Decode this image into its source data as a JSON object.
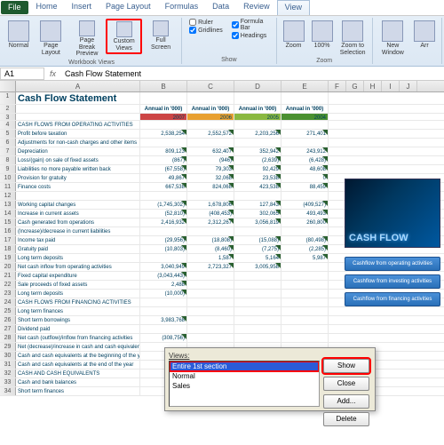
{
  "tabs": [
    "File",
    "Home",
    "Insert",
    "Page Layout",
    "Formulas",
    "Data",
    "Review",
    "View"
  ],
  "active_tab": "View",
  "ribbon": {
    "workbook_views": {
      "title": "Workbook Views",
      "items": [
        "Normal",
        "Page Layout",
        "Page Break Preview",
        "Custom Views",
        "Full Screen"
      ]
    },
    "show": {
      "title": "Show",
      "checks": [
        {
          "label": "Ruler",
          "checked": false
        },
        {
          "label": "Formula Bar",
          "checked": true
        },
        {
          "label": "Gridlines",
          "checked": true
        },
        {
          "label": "Headings",
          "checked": true
        }
      ]
    },
    "zoom": {
      "title": "Zoom",
      "items": [
        "Zoom",
        "100%",
        "Zoom to Selection"
      ]
    },
    "window": {
      "items": [
        "New Window",
        "Arr"
      ]
    }
  },
  "namebox": {
    "cell": "A1",
    "formula": "Cash Flow Statement"
  },
  "columns": [
    "A",
    "B",
    "C",
    "D",
    "E",
    "F",
    "G",
    "H",
    "I",
    "J"
  ],
  "title": "Cash Flow Statement",
  "years": [
    "2007",
    "2006",
    "2005",
    "2004"
  ],
  "sublabel": "Annual in '000)",
  "rows": [
    {
      "label": "CASH FLOWS FROM OPERATING ACTIVITIES",
      "vals": [
        "",
        "",
        "",
        ""
      ]
    },
    {
      "label": "Profit before taxation",
      "vals": [
        "2,538,254",
        "2,552,572",
        "2,203,256",
        "271,401"
      ]
    },
    {
      "label": "Adjustments for non-cash charges and other items",
      "vals": [
        "",
        "",
        "",
        ""
      ]
    },
    {
      "label": "Depreciation",
      "vals": [
        "809,123",
        "632,407",
        "352,942",
        "243,912"
      ]
    },
    {
      "label": "Loss/(gain) on sale of fixed assets",
      "vals": [
        "(867)",
        "(946)",
        "(2,639)",
        "(6,428)"
      ]
    },
    {
      "label": "Liabilities no more payable written back",
      "vals": [
        "(67,558)",
        "79,303",
        "92,429",
        "48,608"
      ]
    },
    {
      "label": "Provision for gratuity",
      "vals": [
        "49,867",
        "32,068",
        "23,538",
        "0"
      ]
    },
    {
      "label": "Finance costs",
      "vals": [
        "667,538",
        "824,068",
        "423,538",
        "88,459"
      ]
    },
    {
      "label": "",
      "vals": [
        "",
        "",
        "",
        ""
      ]
    },
    {
      "label": "Working capital changes",
      "vals": [
        "(1,745,302)",
        "1,678,806",
        "127,843",
        "(409,527)"
      ]
    },
    {
      "label": "Increase in current assets",
      "vals": [
        "(52,810)",
        "(408,453)",
        "302,065",
        "493,493"
      ]
    },
    {
      "label": "Cash generated from operations",
      "vals": [
        "2,416,932",
        "2,312,267",
        "3,056,819",
        "260,800"
      ]
    },
    {
      "label": "(Increase)/decrease in current liabilities",
      "vals": [
        "",
        "",
        "",
        ""
      ]
    },
    {
      "label": "Income tax paid",
      "vals": [
        "(29,956)",
        "(18,808)",
        "(15,088)",
        "(80,498)"
      ]
    },
    {
      "label": "Gratuity paid",
      "vals": [
        "(10,803)",
        "(8,460)",
        "(7,275)",
        "(2,285)"
      ]
    },
    {
      "label": "Long term deposits",
      "vals": [
        "",
        "1,587",
        "5,164",
        "5,987"
      ]
    },
    {
      "label": "Net cash inflow from operating activities",
      "vals": [
        "3,040,949",
        "2,723,327",
        "3,005,958",
        "",
        ""
      ]
    },
    {
      "label": "Fixed capital expenditure",
      "vals": [
        "(3,043,443)",
        "",
        "",
        ""
      ]
    },
    {
      "label": "Sale proceeds of fixed assets",
      "vals": [
        "2,488",
        "",
        "",
        ""
      ]
    },
    {
      "label": "Long term deposits",
      "vals": [
        "(10,000)",
        "",
        "",
        ""
      ]
    },
    {
      "label": "CASH FLOWS FROM FINANCING ACTIVITIES",
      "vals": [
        "",
        "",
        "",
        ""
      ]
    },
    {
      "label": "Long term finances",
      "vals": [
        "",
        "",
        "",
        ""
      ]
    },
    {
      "label": "Short term borrowings",
      "vals": [
        "3,983,768",
        "",
        "",
        ""
      ]
    },
    {
      "label": "Dividend paid",
      "vals": [
        "",
        "",
        "",
        ""
      ]
    },
    {
      "label": "Net cash (outflow)/inflow from financing activities",
      "vals": [
        "(308,756)",
        "",
        "",
        ""
      ]
    },
    {
      "label": "Net (decrease)/increase in cash and cash equivalents",
      "vals": [
        "",
        "",
        "",
        ""
      ]
    },
    {
      "label": "Cash and cash equivalents at the beginning of the year",
      "vals": [
        "",
        "",
        "",
        ""
      ]
    },
    {
      "label": "Cash and cash equivalents at the end of the year",
      "vals": [
        "",
        "",
        "",
        ""
      ]
    },
    {
      "label": "CASH AND CASH EQUIVALENTS",
      "vals": [
        "",
        "",
        "",
        ""
      ]
    },
    {
      "label": "Cash and bank balances",
      "vals": [
        "",
        "",
        "",
        ""
      ]
    },
    {
      "label": "Short term finances",
      "vals": [
        "",
        "",
        "",
        ""
      ]
    }
  ],
  "image_panel": "CASH FLOW",
  "side_buttons": [
    "Cashflow from operating activities",
    "Cashflow from investing activities",
    "Cashflow from financing activities"
  ],
  "dialog": {
    "label": "Views:",
    "items": [
      "Entire 1st section",
      "Normal",
      "Sales"
    ],
    "selected": 0,
    "buttons": [
      "Show",
      "Close",
      "Add...",
      "Delete"
    ]
  }
}
